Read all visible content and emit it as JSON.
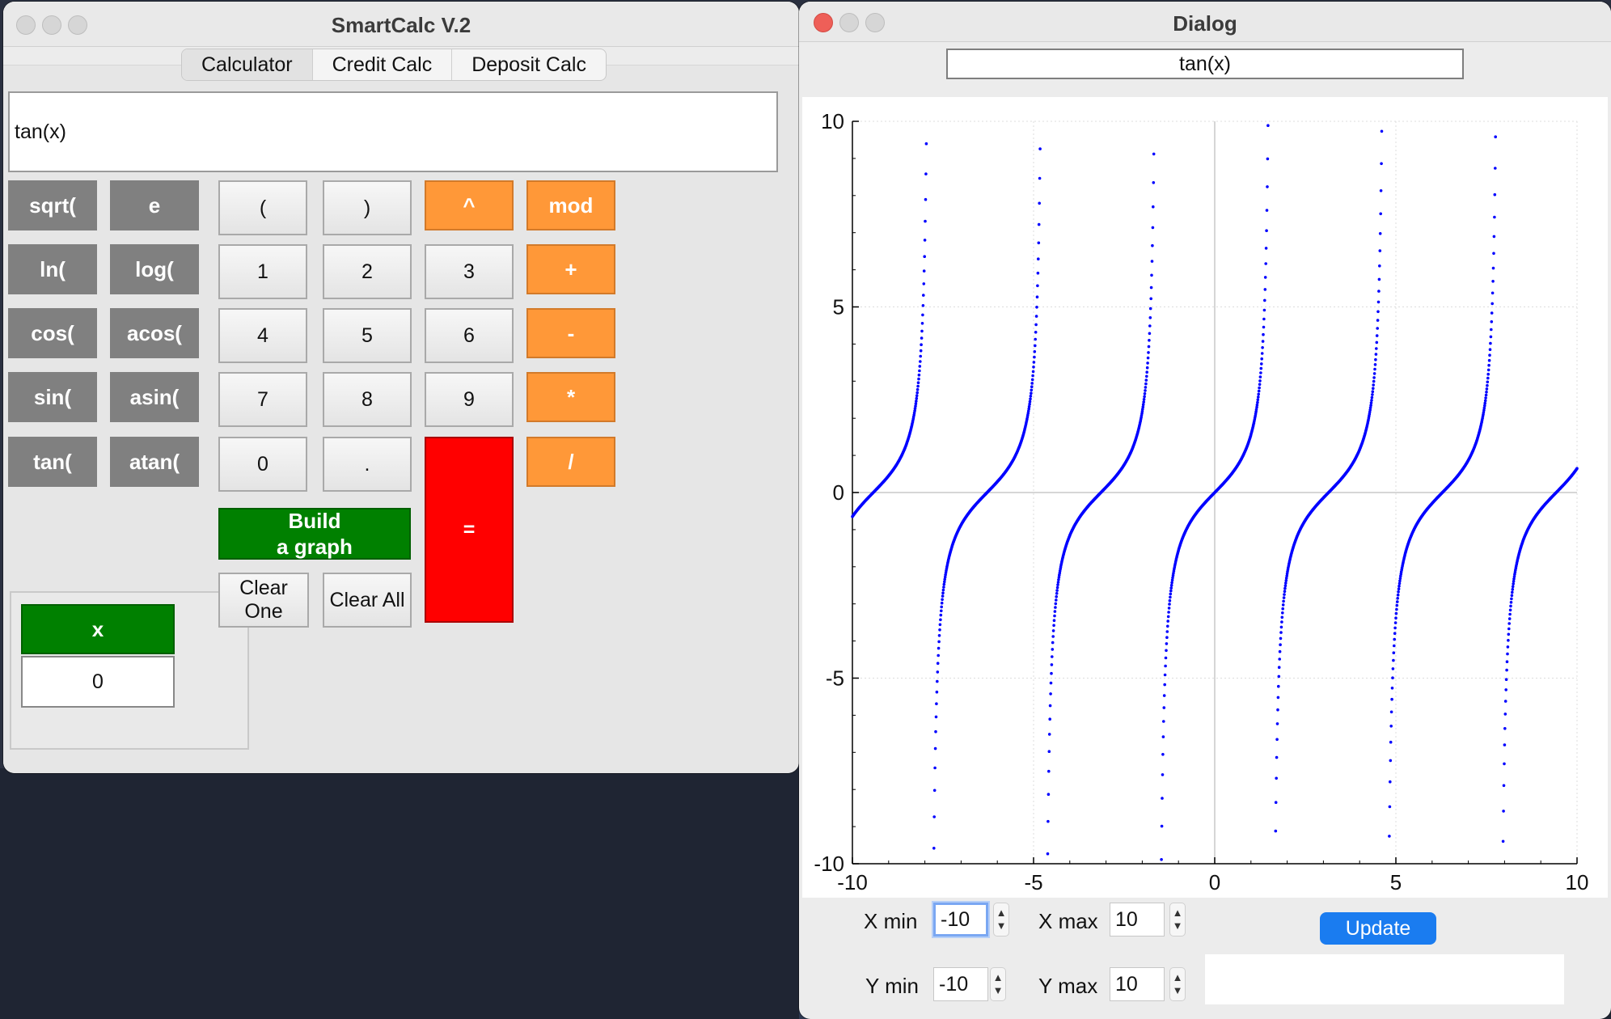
{
  "calc_window": {
    "title": "SmartCalc V.2",
    "tabs": [
      {
        "label": "Calculator",
        "active": true
      },
      {
        "label": "Credit Calc",
        "active": false
      },
      {
        "label": "Deposit Calc",
        "active": false
      }
    ],
    "expression": "tan(x)",
    "func_buttons": [
      "sqrt(",
      "e",
      "ln(",
      "log(",
      "cos(",
      "acos(",
      "sin(",
      "asin(",
      "tan(",
      "atan("
    ],
    "keys": {
      "lparen": "(",
      "rparen": ")",
      "pow": "^",
      "mod": "mod",
      "n1": "1",
      "n2": "2",
      "n3": "3",
      "plus": "+",
      "n4": "4",
      "n5": "5",
      "n6": "6",
      "minus": "-",
      "n7": "7",
      "n8": "8",
      "n9": "9",
      "mul": "*",
      "n0": "0",
      "dot": ".",
      "div": "/",
      "equals": "="
    },
    "x_button": "x",
    "x_value": "0",
    "build_graph_line1": "Build",
    "build_graph_line2": "a graph",
    "clear_one": "Clear One",
    "clear_all": "Clear All"
  },
  "dialog": {
    "title": "Dialog",
    "formula": "tan(x)",
    "controls": {
      "x_min_label": "X min",
      "x_min_value": "-10",
      "x_max_label": "X max",
      "x_max_value": "10",
      "y_min_label": "Y min",
      "y_min_value": "-10",
      "y_max_label": "Y max",
      "y_max_value": "10",
      "update_label": "Update"
    }
  },
  "colors": {
    "func_button": "#808080",
    "operator_button": "#ff9838",
    "equals_button": "#ff0000",
    "green_button": "#008000",
    "plot_points": "#0000ff",
    "update_button": "#1a7cf0"
  },
  "chart_data": {
    "type": "scatter",
    "function": "tan(x)",
    "xlim": [
      -10,
      10
    ],
    "ylim": [
      -10,
      10
    ],
    "xticks": [
      -10,
      -5,
      0,
      5,
      10
    ],
    "yticks": [
      -10,
      -5,
      0,
      5,
      10
    ],
    "x_tick_labels": [
      "-10",
      "-5",
      "0",
      "5",
      "10"
    ],
    "y_tick_labels": [
      "10",
      "5",
      "0",
      "-5",
      "-10"
    ],
    "grid": true,
    "point_color": "#0000ff",
    "sample_step": 0.01
  }
}
